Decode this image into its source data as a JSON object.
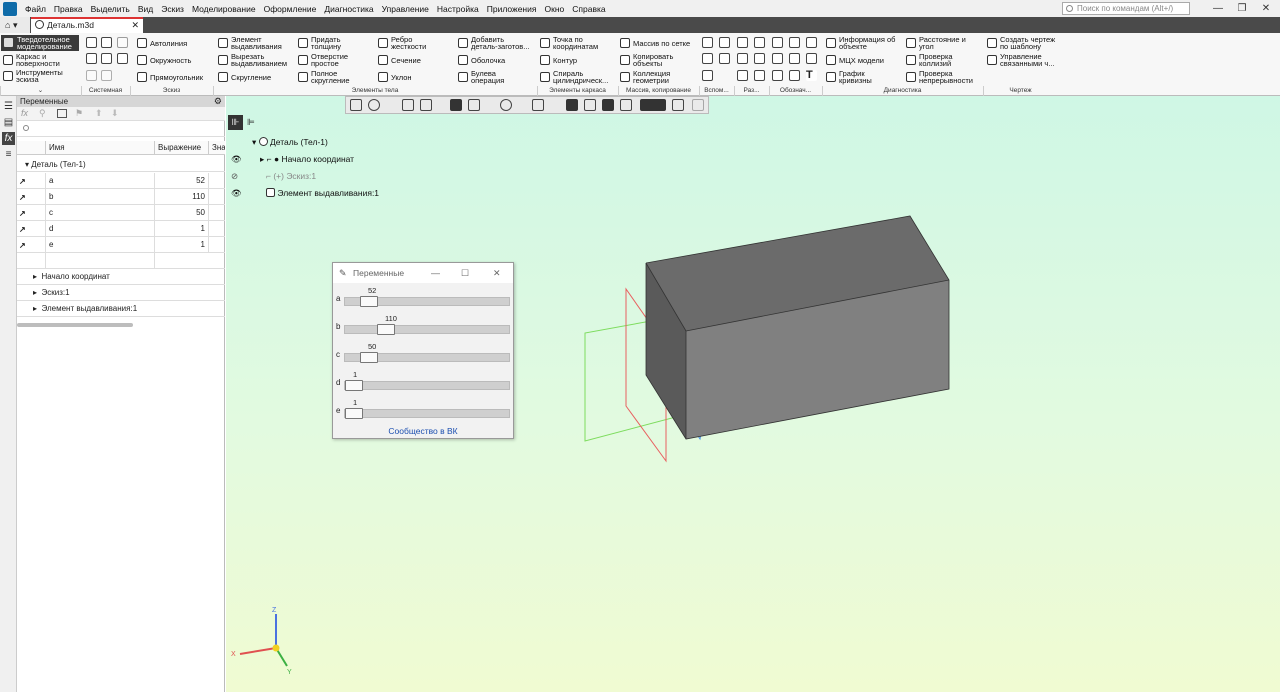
{
  "menu": [
    "Файл",
    "Правка",
    "Выделить",
    "Вид",
    "Эскиз",
    "Моделирование",
    "Оформление",
    "Диагностика",
    "Управление",
    "Настройка",
    "Приложения",
    "Окно",
    "Справка"
  ],
  "search_placeholder": "Поиск по командам (Alt+/)",
  "doc_tab": "Деталь.m3d",
  "modes": {
    "solid": "Твердотельное\nмоделирование",
    "surfaces": "Каркас и\nповерхности",
    "sketch_tools": "Инструменты\nэскиза"
  },
  "ribbon": {
    "autoline": "Автолиния",
    "circle": "Окружность",
    "rectangle": "Прямоугольник",
    "extrude": "Элемент\nвыдавливания",
    "cut_extrude": "Вырезать\nвыдавливанием",
    "fillet": "Скругление",
    "thickness": "Придать\nтолщину",
    "hole": "Отверстие\nпростое",
    "full_fillet": "Полное\nскругление",
    "rib": "Ребро\nжесткости",
    "section": "Сечение",
    "draft": "Уклон",
    "add_blank": "Добавить\nдеталь-заготов...",
    "shell": "Оболочка",
    "boolean": "Булева\nоперация",
    "point": "Точка по\nкоординатам",
    "contour": "Контур",
    "spiral": "Спираль\nцилиндрическ...",
    "grid_array": "Массив по сетке",
    "copy_objects": "Копировать\nобъекты",
    "geometry_collection": "Коллекция\nгеометрии",
    "object_info": "Информация об\nобъекте",
    "mass_center": "МЦХ модели",
    "curvature": "График\nкривизны",
    "distance": "Расстояние и\nугол",
    "collisions": "Проверка\nколлизий",
    "continuity": "Проверка\nнепрерывности",
    "create_drawing": "Создать чертеж\nпо шаблону",
    "manage_linked": "Управление\nсвязанными ч..."
  },
  "groups": {
    "system": "Системная",
    "sketch": "Эскиз",
    "body": "Элементы тела",
    "wire": "Элементы каркаса",
    "array": "Массив, копирование",
    "aux": "Вспом...",
    "parts": "Раз...",
    "notation": "Обознач...",
    "diagnostics": "Диагностика",
    "drawing": "Чертеж"
  },
  "panel": {
    "title": "Переменные",
    "columns": {
      "name": "Имя",
      "expr": "Выражение",
      "value": "Зна"
    },
    "root": "Деталь (Тел-1)",
    "vars": [
      {
        "name": "a",
        "value": "52"
      },
      {
        "name": "b",
        "value": "110"
      },
      {
        "name": "c",
        "value": "50"
      },
      {
        "name": "d",
        "value": "1"
      },
      {
        "name": "e",
        "value": "1"
      }
    ],
    "groups": [
      "Начало координат",
      "Эскиз:1",
      "Элемент выдавливания:1"
    ]
  },
  "tree": {
    "root": "Деталь (Тел-1)",
    "origin": "Начало координат",
    "sketch": "Эскиз:1",
    "extrude": "Элемент выдавливания:1"
  },
  "dialog": {
    "title": "Переменные",
    "sliders": [
      {
        "label": "a",
        "value": 52,
        "fraction": 0.1
      },
      {
        "label": "b",
        "value": 110,
        "fraction": 0.22
      },
      {
        "label": "c",
        "value": 50,
        "fraction": 0.1
      },
      {
        "label": "d",
        "value": 1,
        "fraction": 0.0
      },
      {
        "label": "e",
        "value": 1,
        "fraction": 0.0
      }
    ],
    "link": "Сообщество в ВК"
  },
  "axes": {
    "x": "X",
    "y": "Y",
    "z": "Z"
  },
  "colors": {
    "body": "#808080",
    "body_top": "#6b6b6b",
    "body_side": "#5a5a5a",
    "plane_green": "#7ddc5e",
    "plane_red": "#e86060",
    "plane_blue": "#4a90e2"
  }
}
